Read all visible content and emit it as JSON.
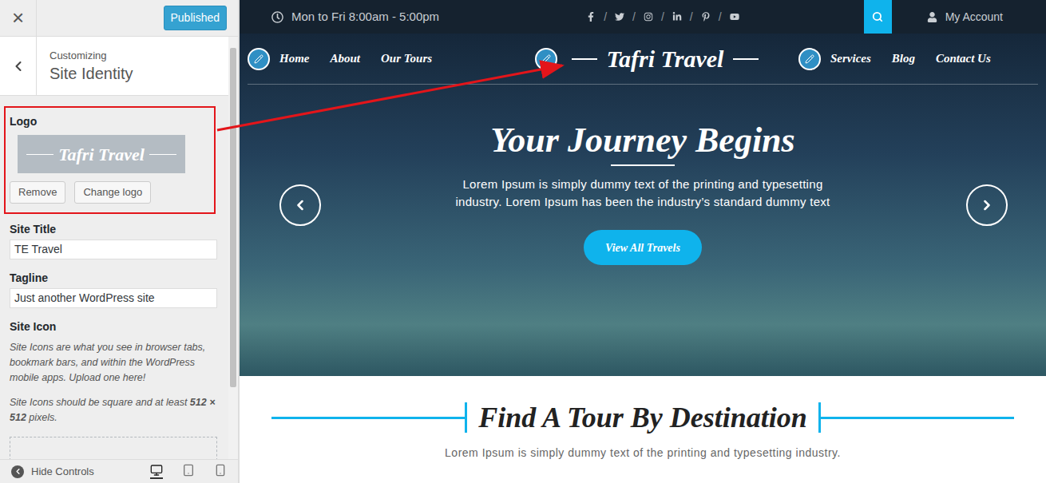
{
  "customizer": {
    "close": "×",
    "publish_button": "Published",
    "breadcrumb": "Customizing",
    "section_title": "Site Identity",
    "logo": {
      "label": "Logo",
      "preview_text": "Tafri Travel",
      "highlighted": true,
      "buttons": [
        "Remove",
        "Change logo"
      ]
    },
    "fields": [
      {
        "label": "Site Title",
        "value": "TE Travel"
      },
      {
        "label": "Tagline",
        "value": "Just another WordPress site"
      }
    ],
    "site_icon": {
      "label": "Site Icon",
      "description": "Site Icons are what you see in browser tabs, bookmark bars, and within the WordPress mobile apps. Upload one here!",
      "size_note": {
        "before": "Site Icons should be square and at least ",
        "bold": "512 × 512",
        "after": " pixels."
      }
    },
    "footer": {
      "hide_controls": "Hide Controls",
      "devices": [
        {
          "device": "desktop",
          "selected": true
        },
        {
          "device": "tablet",
          "selected": false
        },
        {
          "device": "mobile",
          "selected": false
        }
      ]
    }
  },
  "preview": {
    "topbar": {
      "hours": "Mon to Fri 8:00am - 5:00pm",
      "separator": "/",
      "account": "My Account"
    },
    "nav": {
      "left": [
        "Home",
        "About",
        "Our Tours"
      ],
      "logo": "Tafri Travel",
      "right": [
        "Services",
        "Blog",
        "Contact Us"
      ]
    },
    "hero": {
      "title": "Your Journey Begins",
      "text": "Lorem Ipsum is simply dummy text of the printing and typesetting industry. Lorem Ipsum has been the industry’s standard dummy text",
      "button": "View All Travels"
    },
    "section": {
      "title": "Find A Tour By Destination",
      "subtitle": "Lorem Ipsum is simply dummy text of the printing and typesetting industry."
    }
  }
}
